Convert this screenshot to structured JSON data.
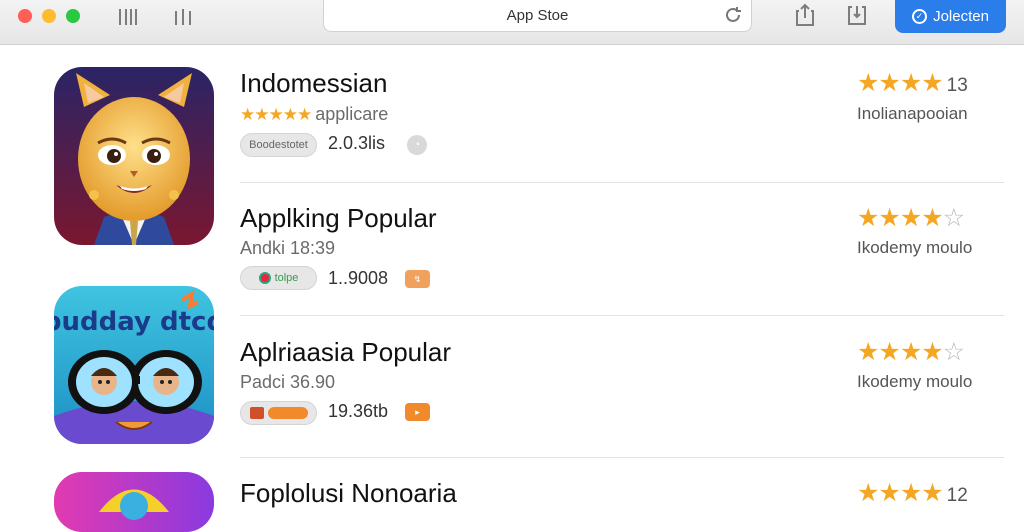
{
  "window": {
    "address": "App Stoe",
    "action_button": "Jolecten"
  },
  "apps": [
    {
      "title": "Indomessian",
      "subtitle": "applicare",
      "subtitle_stars": "★★★★★",
      "pill": "Boodestotet",
      "meta": "2.0.3lis",
      "rating_stars": 4,
      "rating_count": "13",
      "developer": "Inolianapooian"
    },
    {
      "title": "Applking Popular",
      "subtitle": "Andki 18:39",
      "pill": "tolpe",
      "meta": "1..9008",
      "badge": "↯",
      "rating_stars": 4,
      "rating_count": "",
      "developer": "Ikodemy moulo"
    },
    {
      "title": "Aplriaasia Popular",
      "subtitle": "Padci 36.90",
      "pill": "",
      "meta": "19.36tb",
      "badge": "▸",
      "rating_stars": 4,
      "rating_count": "",
      "developer": "Ikodemy moulo"
    },
    {
      "title": "Foplolusi Nonoaria",
      "rating_stars": 4,
      "rating_count": "12"
    }
  ],
  "icons": {
    "icon2_text": "budday dtcd"
  },
  "colors": {
    "accent": "#2b7de9",
    "star": "#f5a623"
  }
}
